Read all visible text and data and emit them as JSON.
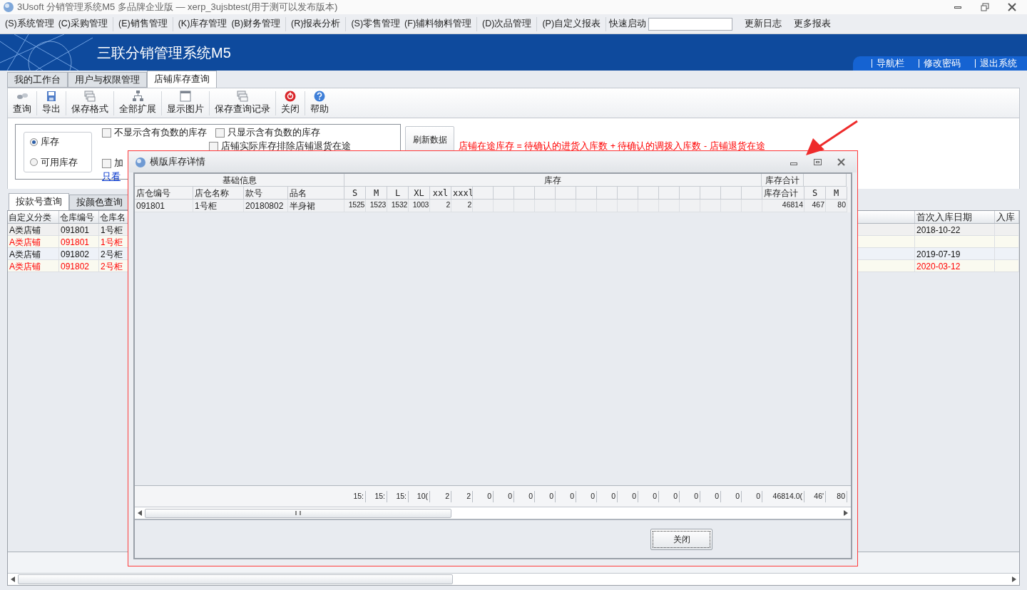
{
  "window": {
    "title": "3Usoft 分销管理系统M5 多品牌企业版 — xerp_3ujsbtest(用于测可以发布版本)"
  },
  "menu": [
    "(S)系统管理",
    "(C)采购管理",
    "(E)销售管理",
    "(K)库存管理",
    "(B)财务管理",
    "(R)报表分析",
    "(S)零售管理",
    "(F)辅料物料管理",
    "(D)次品管理",
    "(P)自定义报表"
  ],
  "quick_launch": {
    "label": "快速启动"
  },
  "menu_links": [
    "更新日志",
    "更多报表"
  ],
  "banner": {
    "title": "三联分销管理系统M5",
    "links": [
      "导航栏",
      "修改密码",
      "退出系统"
    ]
  },
  "tabs": [
    {
      "label": "我的工作台",
      "selected": false
    },
    {
      "label": "用户与权限管理",
      "selected": false
    },
    {
      "label": "店铺库存查询",
      "selected": true
    }
  ],
  "toolbar": [
    "查询",
    "导出",
    "保存格式",
    "全部扩展",
    "显示图片",
    "保存查询记录",
    "关闭",
    "帮助"
  ],
  "filters": {
    "radios": [
      {
        "label": "库存",
        "selected": true
      },
      {
        "label": "可用库存",
        "selected": false
      }
    ],
    "checkboxes": [
      {
        "label": "不显示含有负数的库存",
        "checked": false
      },
      {
        "label": "只显示含有负数的库存",
        "checked": false
      },
      {
        "label": "店铺实际库存排除店铺退货在途",
        "checked": false
      },
      {
        "label": "加",
        "checked": false
      }
    ],
    "link": "只看",
    "refresh_button": "刷新数据",
    "note": "店铺在途库存 = 待确认的进货入库数 + 待确认的调拨入库数 - 店铺退货在途"
  },
  "query_tabs": [
    {
      "label": "按款号查询",
      "selected": true
    },
    {
      "label": "按颜色查询",
      "selected": false
    }
  ],
  "table": {
    "columns_left": [
      "自定义分类",
      "仓库编号",
      "仓库名"
    ],
    "columns_right": [
      "首次入库日期",
      "入库"
    ],
    "rows": [
      {
        "category": "A类店铺",
        "code": "091801",
        "name": "1号柜",
        "date": "2018-10-22",
        "highlighted": false
      },
      {
        "category": "A类店铺",
        "code": "091801",
        "name": "1号柜",
        "date": "",
        "highlighted": true
      },
      {
        "category": "A类店铺",
        "code": "091802",
        "name": "2号柜",
        "date": "2019-07-19",
        "highlighted": false
      },
      {
        "category": "A类店铺",
        "code": "091802",
        "name": "2号柜",
        "date": "2020-03-12",
        "highlighted": true
      }
    ]
  },
  "dialog": {
    "title": "横版库存详情",
    "groups": [
      "基础信息",
      "库存",
      "库存合计"
    ],
    "columns": [
      "店仓编号",
      "店仓名称",
      "款号",
      "品名"
    ],
    "size_columns": [
      "S",
      "M",
      "L",
      "XL",
      "xxl",
      "xxxl"
    ],
    "total_columns": [
      "库存合计",
      "S",
      "M"
    ],
    "row": {
      "cells": [
        "091801",
        "1号柜",
        "20180802",
        "半身裙"
      ],
      "sizes": [
        "1525",
        "1523",
        "1532",
        "1003",
        "2",
        "2"
      ],
      "totals": [
        "46814",
        "467",
        "80"
      ]
    },
    "footer": [
      "15:",
      "15:",
      "15:",
      "10(",
      "2",
      "2",
      "0",
      "0",
      "0",
      "0",
      "0",
      "0",
      "0",
      "0",
      "0",
      "0",
      "0",
      "0",
      "0",
      "0",
      "46814.0(",
      "46'",
      "80"
    ],
    "close_button": "关闭"
  }
}
